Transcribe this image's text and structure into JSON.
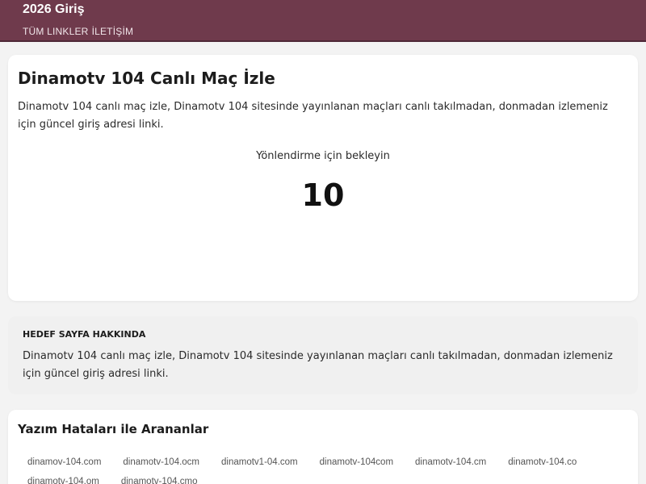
{
  "header": {
    "site_title": "2026 Giriş",
    "nav": [
      "TÜM LINKLER",
      "İLETİŞİM"
    ],
    "background": "#6f3a4c"
  },
  "main": {
    "title": "Dinamotv 104 Canlı Maç İzle",
    "description": "Dinamotv 104 canlı maç izle, Dinamotv 104 sitesinde yayınlanan maçları canlı takılmadan, donmadan izlemeniz için güncel giriş adresi linki.",
    "redirect_label": "Yönlendirme için bekleyin",
    "countdown": "10"
  },
  "about": {
    "heading": "HEDEF SAYFA HAKKINDA",
    "text": "Dinamotv 104 canlı maç izle, Dinamotv 104 sitesinde yayınlanan maçları canlı takılmadan, donmadan izlemeniz için güncel giriş adresi linki."
  },
  "typos": {
    "title": "Yazım Hataları ile Arananlar",
    "items": [
      "dinamov-104.com",
      "dinamotv-104.ocm",
      "dinamotv1-04.com",
      "dinamotv-104com",
      "dinamotv-104.cm",
      "dinamotv-104.co",
      "dinamotv-104.om",
      "dinamotv-104.cmo"
    ]
  }
}
